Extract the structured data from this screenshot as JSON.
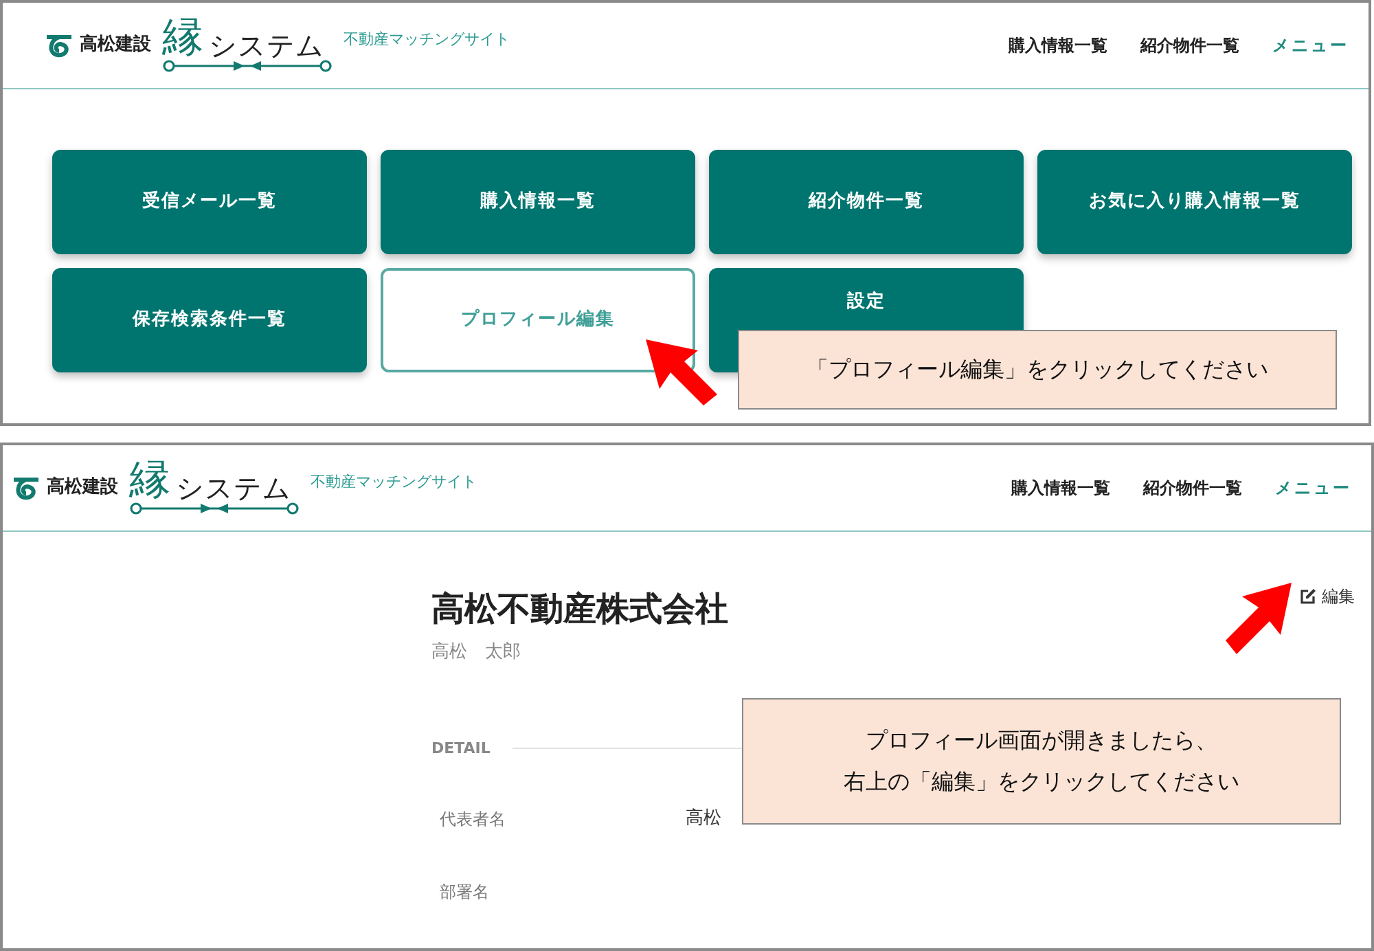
{
  "step_1": {
    "header": {
      "brand": "高松建設",
      "system_mark": "縁",
      "system_name": "システム",
      "tagline": "不動産マッチングサイト",
      "nav": [
        {
          "label": "購入情報一覧",
          "kind": "link"
        },
        {
          "label": "紹介物件一覧",
          "kind": "link"
        },
        {
          "label": "メニュー",
          "kind": "menu"
        }
      ]
    },
    "tiles": [
      {
        "label": "受信メール一覧",
        "highlighted": false
      },
      {
        "label": "購入情報一覧",
        "highlighted": false
      },
      {
        "label": "紹介物件一覧",
        "highlighted": false
      },
      {
        "label": "お気に入り購入情報一覧",
        "highlighted": false
      },
      {
        "label": "保存検索条件一覧",
        "highlighted": false
      },
      {
        "label": "プロフィール編集",
        "highlighted": true
      },
      {
        "label": "設定",
        "highlighted": false
      }
    ],
    "callout": {
      "lines": [
        "「プロフィール編集」をクリックしてください"
      ]
    }
  },
  "step_2": {
    "header": {
      "brand": "高松建設",
      "system_mark": "縁",
      "system_name": "システム",
      "tagline": "不動産マッチングサイト",
      "nav": [
        {
          "label": "購入情報一覧",
          "kind": "link"
        },
        {
          "label": "紹介物件一覧",
          "kind": "link"
        },
        {
          "label": "メニュー",
          "kind": "menu"
        }
      ]
    },
    "company": "高松不動産株式会社",
    "person": "高松　太郎",
    "edit_label": "編集",
    "section": "DETAIL",
    "fields": [
      {
        "label": "代表者名",
        "value": "高松"
      },
      {
        "label": "部署名"
      }
    ],
    "callout": {
      "lines": [
        "プロフィール画面が開きましたら、",
        "右上の「編集」をクリックしてください"
      ]
    }
  }
}
